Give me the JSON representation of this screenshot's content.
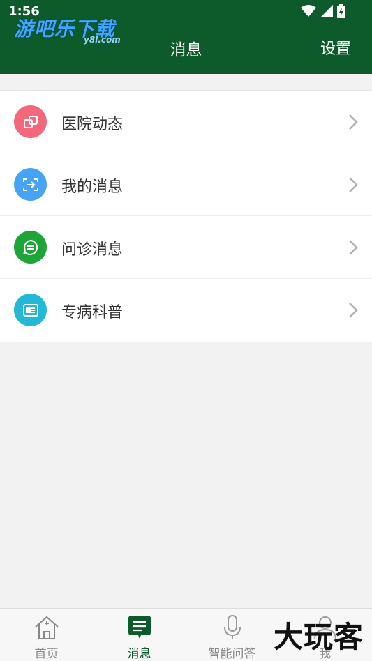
{
  "status": {
    "time": "1:56"
  },
  "watermark": {
    "text": "游吧乐下载",
    "sub": "y8l.com"
  },
  "header": {
    "title": "消息",
    "settings_label": "设置"
  },
  "list": {
    "items": [
      {
        "label": "医院动态",
        "icon": "copy-icon",
        "color": "#f5677b"
      },
      {
        "label": "我的消息",
        "icon": "message-transfer-icon",
        "color": "#47a4f5"
      },
      {
        "label": "问诊消息",
        "icon": "chat-icon",
        "color": "#1ea53a"
      },
      {
        "label": "专病科普",
        "icon": "news-icon",
        "color": "#22b8d6"
      }
    ]
  },
  "nav": {
    "items": [
      {
        "label": "首页",
        "icon": "home-icon",
        "active": false
      },
      {
        "label": "消息",
        "icon": "message-icon",
        "active": true
      },
      {
        "label": "智能问答",
        "icon": "microphone-icon",
        "active": false
      },
      {
        "label": "我",
        "icon": "user-icon",
        "active": false
      }
    ]
  },
  "overlay_brand": "大玩客",
  "colors": {
    "header": "#0d5a2a",
    "accent": "#0d5a2a",
    "background": "#f2f2f2"
  }
}
